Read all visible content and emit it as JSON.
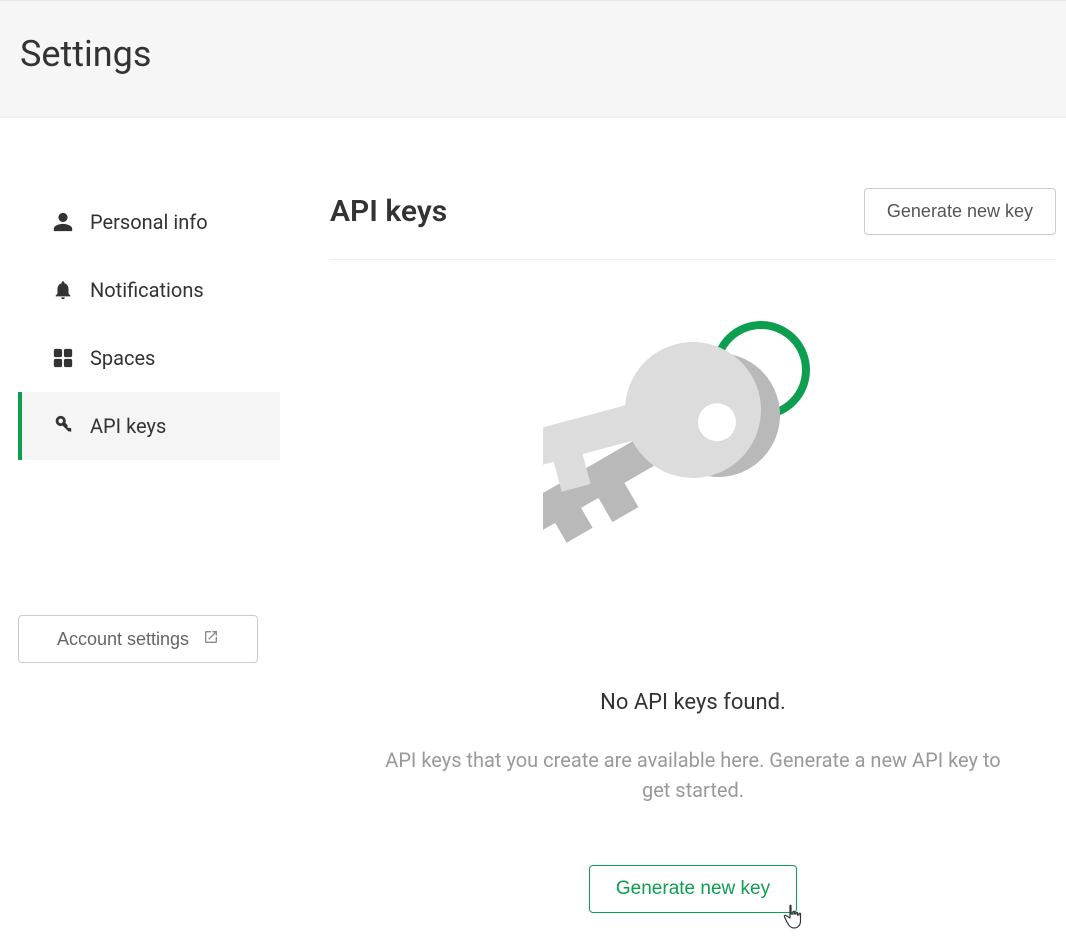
{
  "header": {
    "title": "Settings"
  },
  "sidebar": {
    "items": [
      {
        "label": "Personal info"
      },
      {
        "label": "Notifications"
      },
      {
        "label": "Spaces"
      },
      {
        "label": "API keys"
      }
    ],
    "account_settings_label": "Account settings"
  },
  "main": {
    "title": "API keys",
    "generate_top_label": "Generate new key",
    "empty": {
      "title": "No API keys found.",
      "description": "API keys that you create are available here. Generate a new API key to get started.",
      "generate_label": "Generate new key"
    }
  },
  "colors": {
    "accent": "#0d9e4f"
  }
}
